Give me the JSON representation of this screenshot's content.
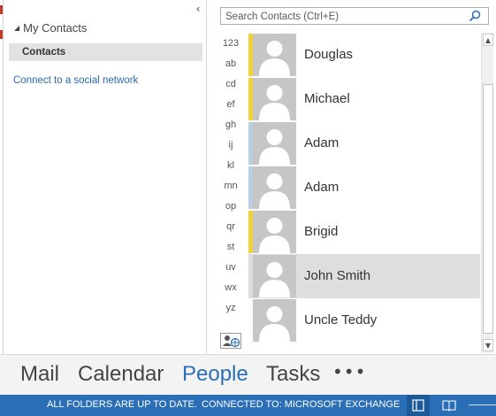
{
  "folder_pane": {
    "collapse_icon": "chevron-left-icon",
    "group_label": "My Contacts",
    "selected_folder": "Contacts",
    "social_link": "Connect to a social network"
  },
  "search": {
    "placeholder": "Search Contacts (Ctrl+E)",
    "value": "",
    "icon": "search-icon"
  },
  "alpha_index": [
    "123",
    "ab",
    "cd",
    "ef",
    "gh",
    "ij",
    "kl",
    "mn",
    "op",
    "qr",
    "st",
    "uv",
    "wx",
    "yz"
  ],
  "contacts": [
    {
      "name": "Douglas",
      "category_color": "#f2d038",
      "selected": false
    },
    {
      "name": "Michael",
      "category_color": "#f2d038",
      "selected": false
    },
    {
      "name": "Adam",
      "category_color": "#b8d0e0",
      "selected": false
    },
    {
      "name": "Adam",
      "category_color": "#b8d0e0",
      "selected": false
    },
    {
      "name": "Brigid",
      "category_color": "#f2d038",
      "selected": false
    },
    {
      "name": "John Smith",
      "category_color": "",
      "selected": true
    },
    {
      "name": "Uncle Teddy",
      "category_color": "",
      "selected": false
    }
  ],
  "navigation": {
    "mail": "Mail",
    "calendar": "Calendar",
    "people": "People",
    "tasks": "Tasks",
    "more": "•••",
    "active": "People"
  },
  "status_bar": {
    "folders_status": "ALL FOLDERS ARE UP TO DATE.",
    "connection_status": "CONNECTED TO: MICROSOFT EXCHANGE"
  },
  "colors": {
    "accent": "#2a6fb6",
    "category_yellow": "#f2d038",
    "selected_row": "#dedede"
  }
}
